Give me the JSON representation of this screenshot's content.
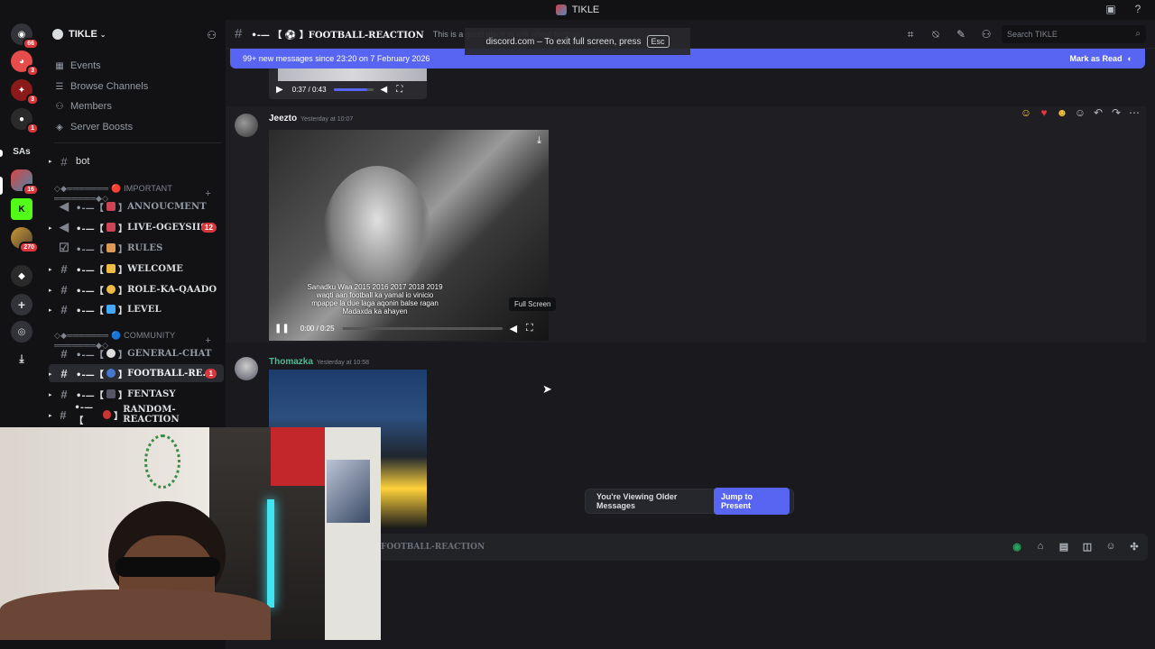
{
  "window": {
    "title": "TIKLE"
  },
  "rail": {
    "badges": [
      "66",
      "3",
      "3",
      "1",
      "16",
      "270"
    ],
    "folder_label": "SAs"
  },
  "guild": {
    "name": "TIKLE"
  },
  "nav": {
    "events": "Events",
    "browse_channels": "Browse Channels",
    "members": "Members",
    "server_boosts": "Server Boosts"
  },
  "channels": {
    "bot": "bot",
    "cat_important": "◇◆═══════ 🔴 IMPORTANT ═══════◆◇",
    "annoucement": "ANNOUCMENT",
    "live": "LIVE-OGEYSIIS",
    "live_badge": "12",
    "rules": "RULES",
    "welcome": "WELCOME",
    "role": "ROLE-KA-QAADO",
    "level": "LEVEL",
    "cat_community": "◇◆═══════ 🔵 COMMUNITY ═══════◆◇",
    "general": "GENERAL-CHAT",
    "football": "FOOTBALL-RE...",
    "football_badge": "1",
    "fentasy": "FENTASY",
    "random": "RANDOM-REACTION"
  },
  "header": {
    "channel_name": "•-— 【 ⚽ 】FOOTBALL-REACTION",
    "topic": "This is a good place to talk about football",
    "search_placeholder": "Search TIKLE"
  },
  "fullscreen_toast": {
    "text": "discord.com – To exit full screen, press",
    "key": "Esc"
  },
  "new_messages_bar": {
    "text": "99+ new messages since 23:20 on 7 February 2026",
    "action": "Mark as Read"
  },
  "media_top": {
    "time": "0:37 / 0:43",
    "progress": 0.86
  },
  "messages": [
    {
      "author": "Jeezto",
      "timestamp": "Yesterday at 10:07",
      "video_time": "0:00 / 0:25",
      "progress": 0.01,
      "caption": "Sanadku Waa 2015 2016 2017  2018 2019  waqti aan  football ka yamal io vinicio mpappe la due laga aqonin balse ragan Madaxda ka ahayen",
      "tooltip": "Full Screen"
    },
    {
      "author": "Thomazka",
      "timestamp": "Yesterday at 10:58"
    }
  ],
  "older_bar": {
    "text": "You're Viewing Older Messages",
    "action": "Jump to Present"
  },
  "composer": {
    "placeholder": "FOOTBALL-REACTION"
  },
  "colors": {
    "blurple": "#5865f2",
    "red_badge": "#da373c",
    "green_name": "#4dbb8f"
  }
}
